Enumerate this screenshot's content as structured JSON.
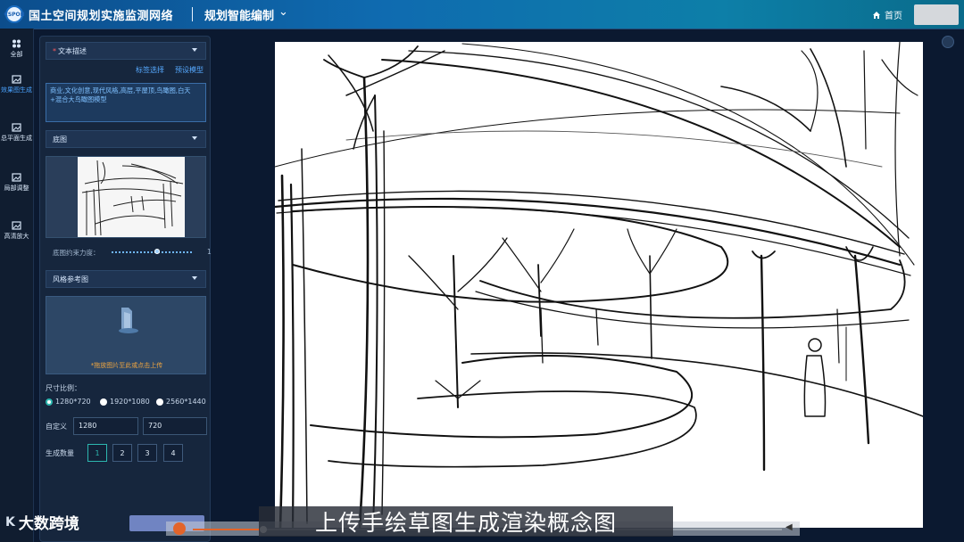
{
  "header": {
    "logo_text": "CSPON",
    "app_title": "国土空间规划实施监测网络",
    "module_title": "规划智能编制",
    "home_label": "首页"
  },
  "sidenav": {
    "items": [
      {
        "label": "全部",
        "active": false
      },
      {
        "label": "效果图生成",
        "active": true
      },
      {
        "label": "总平面生成",
        "active": false
      },
      {
        "label": "局部调整",
        "active": false
      },
      {
        "label": "高清放大",
        "active": false
      }
    ]
  },
  "panel": {
    "text_desc": {
      "title": "文本描述",
      "tag_select": "标签选择",
      "preset_model": "预设模型",
      "prompt": "商业,文化创意,现代风格,高层,平屋顶,鸟瞰图,白天+混合大鸟瞰图模型"
    },
    "base_image": {
      "title": "底图",
      "constraint_label": "底图约束力度：",
      "constraint_value": "1",
      "constraint_level": 0.55
    },
    "style_ref": {
      "title": "风格参考图",
      "upload_hint": "*拖放图片至此或点击上传"
    },
    "size": {
      "label": "尺寸比例：",
      "options": [
        "1280*720",
        "1920*1080",
        "2560*1440"
      ],
      "selected": "1280*720",
      "custom_label": "自定义",
      "width": "1280",
      "height": "720"
    },
    "count": {
      "label": "生成数量",
      "options": [
        "1",
        "2",
        "3",
        "4"
      ],
      "selected": "1"
    }
  },
  "video": {
    "brand": "大数跨境",
    "brand_mark": "K",
    "subtitle": "上传手绘草图生成渲染概念图",
    "progress": 0.12
  },
  "colors": {
    "accent": "#4aa3ff",
    "teal": "#2db7b0",
    "warning": "#f0a640"
  }
}
